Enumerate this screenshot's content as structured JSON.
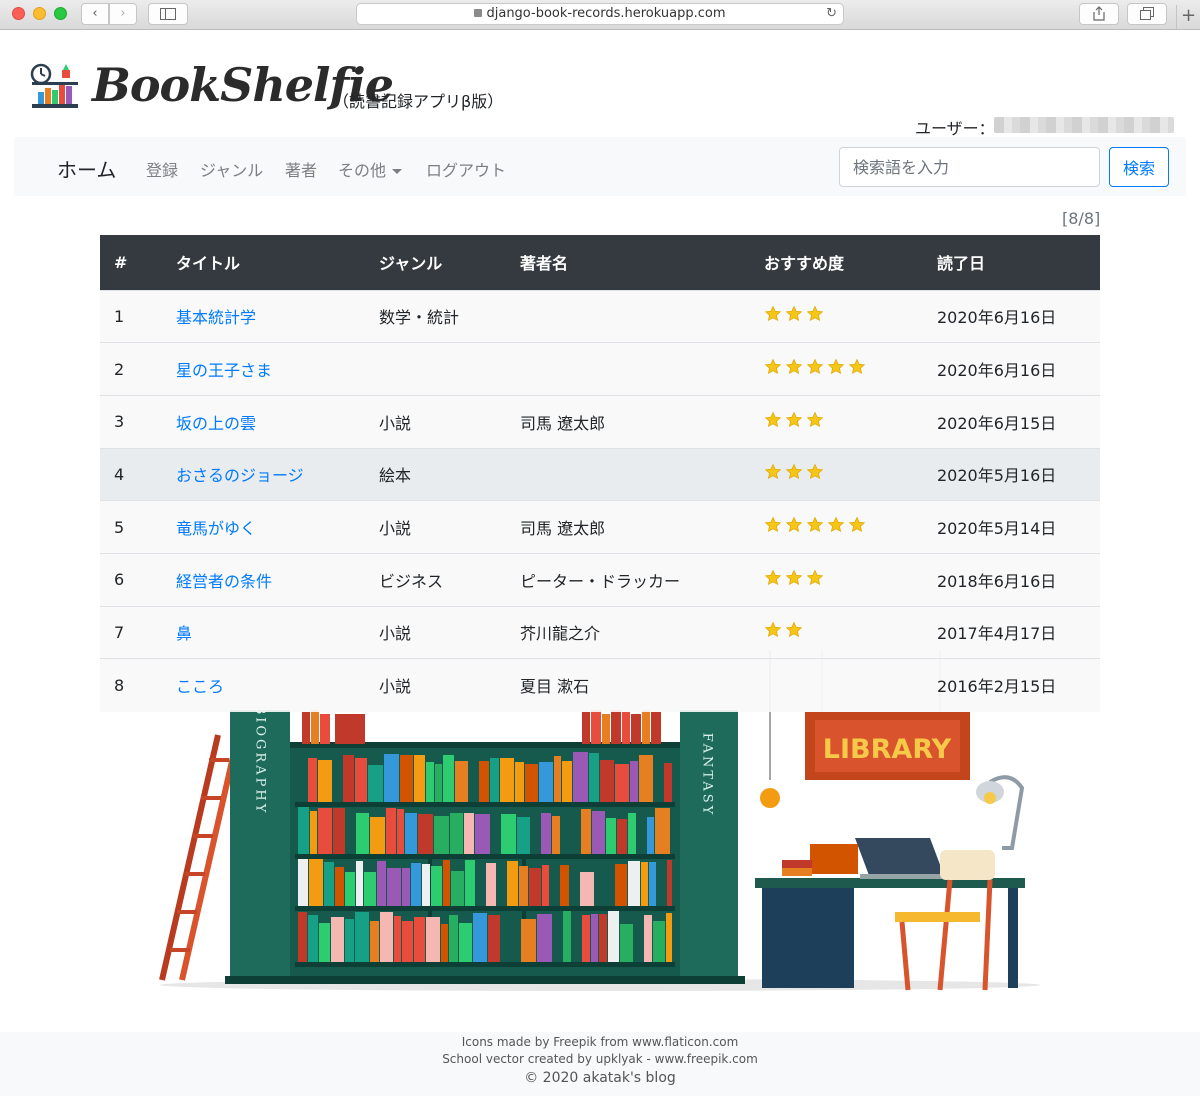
{
  "browser": {
    "url": "django-book-records.herokuapp.com"
  },
  "header": {
    "brand_name": "BookShelfie",
    "brand_subtitle": "（読書記録アプリβ版）",
    "user_label": "ユーザー："
  },
  "nav": {
    "home": "ホーム",
    "items": [
      "登録",
      "ジャンル",
      "著者",
      "その他",
      "ログアウト"
    ],
    "search_placeholder": "検索語を入力",
    "search_button": "検索"
  },
  "page_count": "[8/8]",
  "table": {
    "headers": [
      "#",
      "タイトル",
      "ジャンル",
      "著者名",
      "おすすめ度",
      "読了日"
    ],
    "rows": [
      {
        "no": "1",
        "title": "基本統計学",
        "genre": "数学・統計",
        "author": "",
        "rating": 3,
        "date": "2020年6月16日"
      },
      {
        "no": "2",
        "title": "星の王子さま",
        "genre": "",
        "author": "",
        "rating": 5,
        "date": "2020年6月16日"
      },
      {
        "no": "3",
        "title": "坂の上の雲",
        "genre": "小説",
        "author": "司馬 遼太郎",
        "rating": 3,
        "date": "2020年6月15日"
      },
      {
        "no": "4",
        "title": "おさるのジョージ",
        "genre": "絵本",
        "author": "",
        "rating": 3,
        "date": "2020年5月16日"
      },
      {
        "no": "5",
        "title": "竜馬がゆく",
        "genre": "小説",
        "author": "司馬 遼太郎",
        "rating": 5,
        "date": "2020年5月14日"
      },
      {
        "no": "6",
        "title": "経営者の条件",
        "genre": "ビジネス",
        "author": "ピーター・ドラッカー",
        "rating": 3,
        "date": "2018年6月16日"
      },
      {
        "no": "7",
        "title": "鼻",
        "genre": "小説",
        "author": "芥川龍之介",
        "rating": 2,
        "date": "2017年4月17日"
      },
      {
        "no": "8",
        "title": "こころ",
        "genre": "小説",
        "author": "夏目 漱石",
        "rating": 0,
        "date": "2016年2月15日"
      }
    ]
  },
  "illustration": {
    "sign": "LIBRARY",
    "left_spine": "BIOGRAPHY",
    "right_spine": "FANTASY"
  },
  "footer": {
    "line1": "Icons made by Freepik from www.flaticon.com",
    "line2": "School vector created by upklyak - www.freepik.com",
    "line3": "© 2020 akatak's blog"
  },
  "colors": {
    "accent": "#007bff",
    "table_header": "#343a40",
    "star": "#f5c518",
    "navbar_bg": "#f8f9fa"
  }
}
